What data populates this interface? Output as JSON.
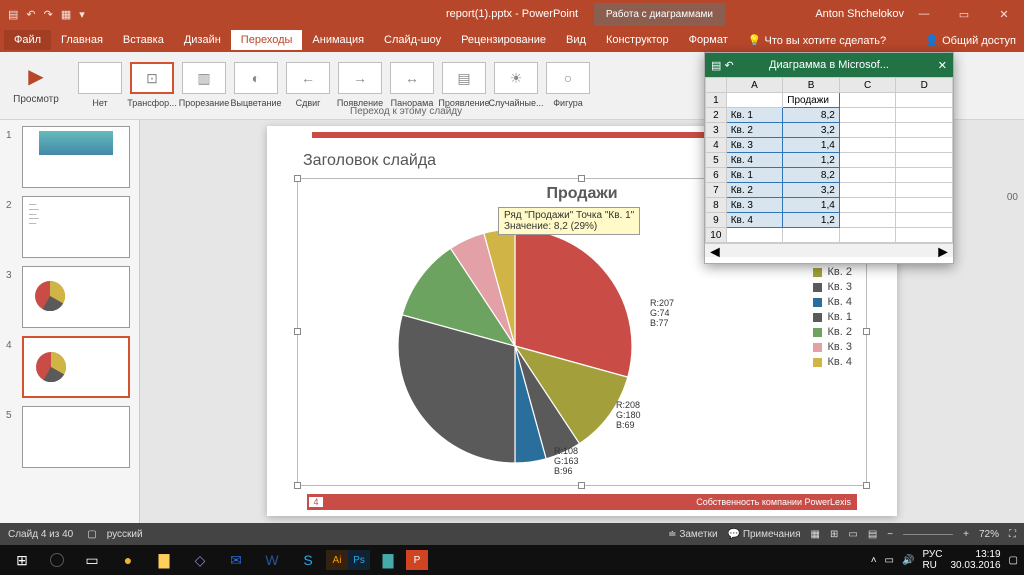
{
  "titlebar": {
    "doc": "report(1).pptx - PowerPoint",
    "chart_tools": "Работа с диаграммами",
    "user": "Anton Shchelokov"
  },
  "tabs": {
    "file": "Файл",
    "home": "Главная",
    "insert": "Вставка",
    "design": "Дизайн",
    "transitions": "Переходы",
    "anim": "Анимация",
    "slideshow": "Слайд-шоу",
    "review": "Рецензирование",
    "view": "Вид",
    "designer": "Конструктор",
    "format": "Формат",
    "tellme": "Что вы хотите сделать?",
    "share": "Общий доступ"
  },
  "ribbon": {
    "preview": "Просмотр",
    "trans": [
      "Нет",
      "Трансфор...",
      "Прорезание",
      "Выцветание",
      "Сдвиг",
      "Появление",
      "Панорама",
      "Проявление",
      "Случайные...",
      "Фигура"
    ],
    "hint": "Переход к этому слайду"
  },
  "slide": {
    "title": "Заголовок слайда",
    "chart_title": "Продажи",
    "tooltip_l1": "Ряд \"Продажи\" Точка \"Кв. 1\"",
    "tooltip_l2": "Значение: 8,2 (29%)",
    "rgb1": "R:207\nG:74\nB:77",
    "rgb2": "R:208\nG:180\nB:69",
    "rgb3": "R:108\nG:163\nB:96",
    "page": "4",
    "owner": "Собственность компании PowerLexis"
  },
  "legend": [
    "Кв. 1",
    "Кв. 2",
    "Кв. 3",
    "Кв. 4",
    "Кв. 1",
    "Кв. 2",
    "Кв. 3",
    "Кв. 4"
  ],
  "legend_colors": [
    "#c94d46",
    "#a3a03b",
    "#5a5a5a",
    "#2a6e9c",
    "#5a5a5a",
    "#6ca360",
    "#e4a0a7",
    "#d0b445"
  ],
  "chart_data": {
    "type": "pie",
    "title": "Продажи",
    "series": [
      {
        "name": "Продажи",
        "categories": [
          "Кв. 1",
          "Кв. 2",
          "Кв. 3",
          "Кв. 4",
          "Кв. 1",
          "Кв. 2",
          "Кв. 3",
          "Кв. 4"
        ],
        "values": [
          8.2,
          3.2,
          1.4,
          1.2,
          8.2,
          3.2,
          1.4,
          1.2
        ]
      }
    ],
    "colors": [
      "#c94d46",
      "#a3a03b",
      "#5a5a5a",
      "#2a6e9c",
      "#5a5a5a",
      "#6ca360",
      "#e4a0a7",
      "#d0b445"
    ]
  },
  "excel": {
    "title": "Диаграмма в Microsof...",
    "cols": [
      "A",
      "B",
      "C",
      "D"
    ],
    "header_b": "Продажи",
    "rows": [
      {
        "r": "2",
        "a": "Кв. 1",
        "b": "8,2"
      },
      {
        "r": "3",
        "a": "Кв. 2",
        "b": "3,2"
      },
      {
        "r": "4",
        "a": "Кв. 3",
        "b": "1,4"
      },
      {
        "r": "5",
        "a": "Кв. 4",
        "b": "1,2"
      },
      {
        "r": "6",
        "a": "Кв. 1",
        "b": "8,2"
      },
      {
        "r": "7",
        "a": "Кв. 2",
        "b": "3,2"
      },
      {
        "r": "8",
        "a": "Кв. 3",
        "b": "1,4"
      },
      {
        "r": "9",
        "a": "Кв. 4",
        "b": "1,2"
      }
    ]
  },
  "status": {
    "slide": "Слайд 4 из 40",
    "lang": "русский",
    "notes": "Заметки",
    "comments": "Примечания",
    "zoom": "72%"
  },
  "tray": {
    "lang1": "РУС",
    "lang2": "RU",
    "time": "13:19",
    "date": "30.03.2016"
  },
  "zoom_val": "00"
}
